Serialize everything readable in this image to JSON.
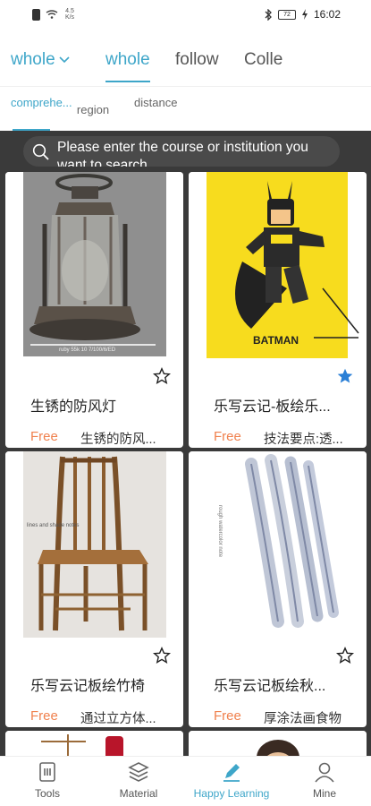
{
  "status_bar": {
    "speed_value": "4.5",
    "speed_unit": "K/s",
    "battery": "72",
    "time": "16:02"
  },
  "top_tabs": {
    "dropdown_label": "whole",
    "tabs": [
      "whole",
      "follow",
      "Colle"
    ],
    "active_index": 0
  },
  "sub_tabs": {
    "tabs": [
      "comprehe...",
      "region",
      "distance"
    ],
    "active_index": 0
  },
  "search": {
    "placeholder": "Please enter the course or institution you want to search"
  },
  "courses": [
    {
      "title": "生锈的防风灯",
      "price": "Free",
      "desc": "生锈的防风...",
      "starred": false
    },
    {
      "title": "乐写云记-板绘乐...",
      "price": "Free",
      "desc": "技法要点:透...",
      "starred": true
    },
    {
      "title": "乐写云记板绘竹椅",
      "price": "Free",
      "desc": "通过立方体...",
      "starred": false
    },
    {
      "title": "乐写云记板绘秋...",
      "price": "Free",
      "desc": "厚涂法画食物",
      "starred": false
    }
  ],
  "card_image_text": {
    "lantern_caption": "ruby 55k 10 7/100/6/ED",
    "batman_label": "BATMAN",
    "chair_note": "lines and shade notes",
    "fish_note": "rough watercolor note"
  },
  "bottom_nav": {
    "items": [
      {
        "label": "Tools",
        "icon": "tools-icon"
      },
      {
        "label": "Material",
        "icon": "layers-icon"
      },
      {
        "label": "Happy Learning",
        "icon": "pen-icon"
      },
      {
        "label": "Mine",
        "icon": "person-icon"
      }
    ],
    "active_index": 2
  },
  "colors": {
    "accent": "#3ea6c9",
    "price": "#f0814e",
    "star_active": "#2a7fd6",
    "dark_strip": "#3a3a3a"
  }
}
